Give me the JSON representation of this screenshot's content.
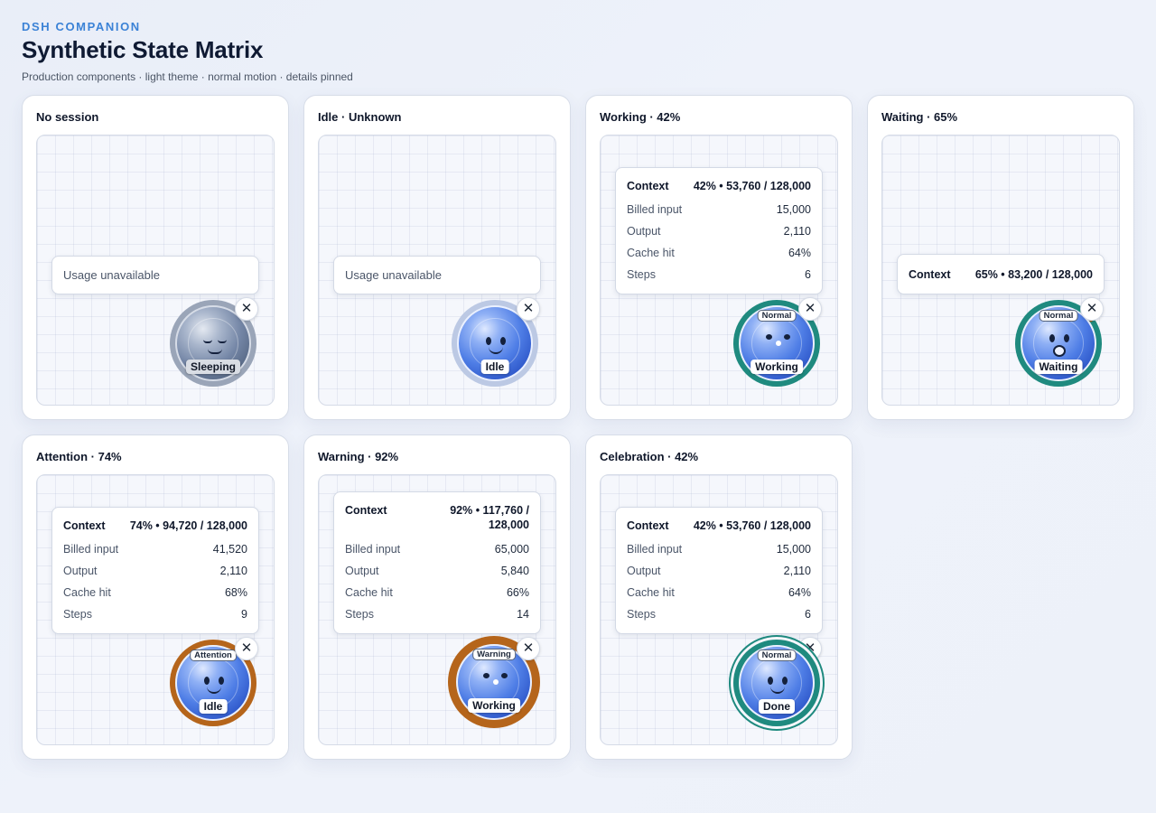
{
  "header": {
    "eyebrow": "DSH COMPANION",
    "title": "Synthetic State Matrix",
    "subtitle": "Production components · light theme · normal motion · details pinned"
  },
  "labels": {
    "context": "Context",
    "billed_input": "Billed input",
    "output": "Output",
    "cache_hit": "Cache hit",
    "steps": "Steps",
    "usage_unavailable": "Usage unavailable",
    "close_glyph": "✕"
  },
  "cards": [
    {
      "title": "No session",
      "state": "Sleeping"
    },
    {
      "title": "Idle · Unknown",
      "state": "Idle"
    },
    {
      "title": "Working · 42%",
      "state": "Working",
      "badge": "Normal",
      "context": "42% • 53,760 / 128,000",
      "billed_input": "15,000",
      "output": "2,110",
      "cache_hit": "64%",
      "steps": "6"
    },
    {
      "title": "Waiting · 65%",
      "state": "Waiting",
      "badge": "Normal",
      "context": "65% • 83,200 / 128,000"
    },
    {
      "title": "Attention · 74%",
      "state": "Idle",
      "badge": "Attention",
      "context": "74% • 94,720 / 128,000",
      "billed_input": "41,520",
      "output": "2,110",
      "cache_hit": "68%",
      "steps": "9"
    },
    {
      "title": "Warning · 92%",
      "state": "Working",
      "badge": "Warning",
      "context": "92% • 117,760 / 128,000",
      "billed_input": "65,000",
      "output": "5,840",
      "cache_hit": "66%",
      "steps": "14"
    },
    {
      "title": "Celebration · 42%",
      "state": "Done",
      "badge": "Normal",
      "context": "42% • 53,760 / 128,000",
      "billed_input": "15,000",
      "output": "2,110",
      "cache_hit": "64%",
      "steps": "6"
    }
  ],
  "colors": {
    "eyebrow": "#3b82d6",
    "ring_normal": "#1f8a7f",
    "ring_alert": "#b5651b",
    "orb_blue": "#4f7ee6",
    "orb_sleep": "#7486a6"
  },
  "icons": [
    "close-icon",
    "companion-face-icon"
  ]
}
